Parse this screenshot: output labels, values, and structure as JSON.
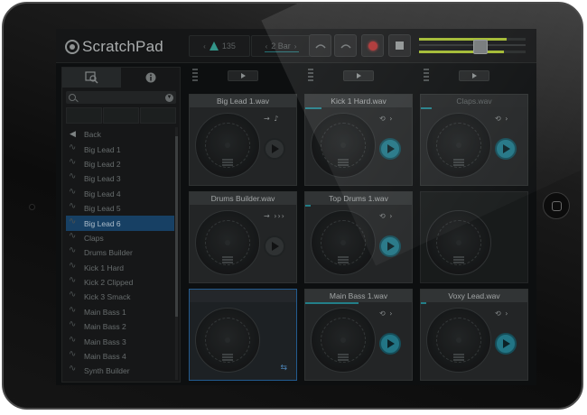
{
  "app": {
    "name": "ScratchPad"
  },
  "transport": {
    "tempo": "135",
    "loop_length": "2 Bar",
    "undo_icon": "undo-arrow-icon",
    "redo_icon": "redo-arrow-icon",
    "record_icon": "record-dot-icon",
    "stop_icon": "stop-square-icon",
    "level_left": 0.82,
    "level_right": 0.8,
    "volume": 0.6
  },
  "browser": {
    "tabs": [
      {
        "icon": "browse-search-icon",
        "active": true
      },
      {
        "icon": "info-icon",
        "active": false
      }
    ],
    "search_placeholder": "",
    "back_label": "Back",
    "files": [
      {
        "label": "Big Lead 1",
        "selected": false
      },
      {
        "label": "Big Lead 2",
        "selected": false
      },
      {
        "label": "Big Lead 3",
        "selected": false
      },
      {
        "label": "Big Lead 4",
        "selected": false
      },
      {
        "label": "Big Lead 5",
        "selected": false
      },
      {
        "label": "Big Lead 6",
        "selected": true
      },
      {
        "label": "Claps",
        "selected": false
      },
      {
        "label": "Drums Builder",
        "selected": false
      },
      {
        "label": "Kick 1 Hard",
        "selected": false
      },
      {
        "label": "Kick 2 Clipped",
        "selected": false
      },
      {
        "label": "Kick 3 Smack",
        "selected": false
      },
      {
        "label": "Main Bass 1",
        "selected": false
      },
      {
        "label": "Main Bass 2",
        "selected": false
      },
      {
        "label": "Main Bass 3",
        "selected": false
      },
      {
        "label": "Main Bass 4",
        "selected": false
      },
      {
        "label": "Synth Builder",
        "selected": false
      }
    ]
  },
  "columns": [
    {
      "pads": [
        {
          "title": "Big Lead 1.wav",
          "state": "loaded",
          "active": false,
          "mode": "→ ♪",
          "progress": 0
        },
        {
          "title": "Drums Builder.wav",
          "state": "loaded",
          "active": false,
          "mode": "→ ›››",
          "progress": 0
        },
        {
          "title": "",
          "state": "selected",
          "active": false,
          "mode": "",
          "progress": 0
        }
      ]
    },
    {
      "pads": [
        {
          "title": "Kick 1 Hard.wav",
          "state": "loaded",
          "active": true,
          "mode": "⟲ ›",
          "progress": 0.15
        },
        {
          "title": "Top Drums 1.wav",
          "state": "loaded",
          "active": true,
          "mode": "⟲ ›",
          "progress": 0.05
        },
        {
          "title": "Main Bass 1.wav",
          "state": "loaded",
          "active": true,
          "mode": "⟲ ›",
          "progress": 0.5
        }
      ]
    },
    {
      "pads": [
        {
          "title": "Claps.wav",
          "state": "dim",
          "active": true,
          "mode": "⟲ ›",
          "progress": 0.1
        },
        {
          "title": "",
          "state": "empty",
          "active": false,
          "mode": "",
          "progress": 0
        },
        {
          "title": "Voxy Lead.wav",
          "state": "loaded",
          "active": true,
          "mode": "⟲ ›",
          "progress": 0.05
        }
      ]
    }
  ]
}
